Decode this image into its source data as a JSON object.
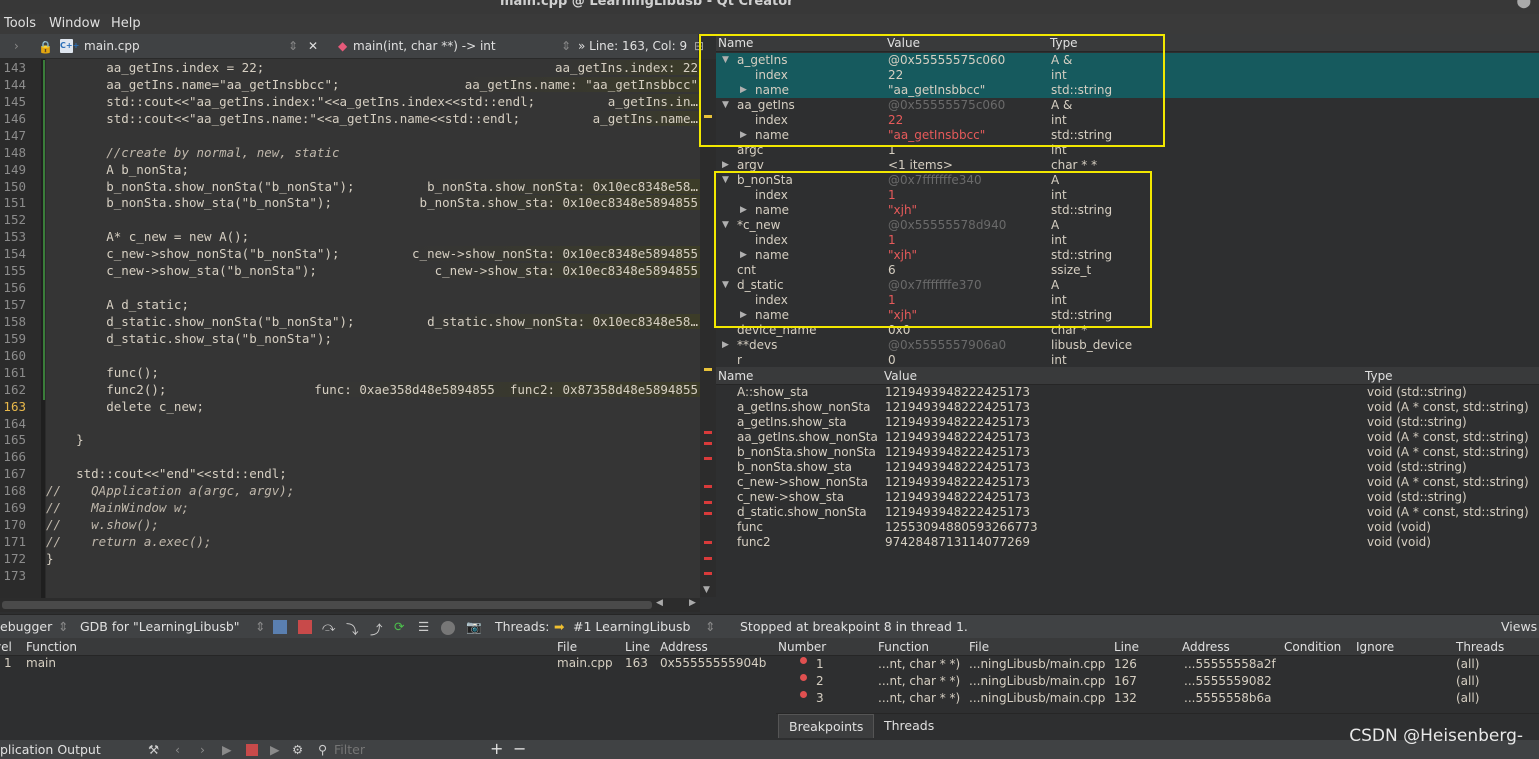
{
  "window": {
    "title": "main.cpp @ LearningLibusb - Qt Creator"
  },
  "menu": [
    "Tools",
    "Window",
    "Help"
  ],
  "editor_toolbar": {
    "file": "main.cpp",
    "function": "main(int, char **) -> int",
    "position": "Line: 163, Col: 9"
  },
  "code_lines": [
    {
      "n": "143",
      "text": "        aa_getIns.index = 22;"
    },
    {
      "n": "144",
      "text": "        aa_getIns.name=\"aa_getInsbbcc\";"
    },
    {
      "n": "145",
      "text": "        std::cout<<\"aa_getIns.index:\"<<a_getIns.index<<std::endl;"
    },
    {
      "n": "146",
      "text": "        std::cout<<\"aa_getIns.name:\"<<a_getIns.name<<std::endl;"
    },
    {
      "n": "147",
      "text": ""
    },
    {
      "n": "148",
      "text": "        //create by normal, new, static"
    },
    {
      "n": "149",
      "text": "        A b_nonSta;"
    },
    {
      "n": "150",
      "text": "        b_nonSta.show_nonSta(\"b_nonSta\");"
    },
    {
      "n": "151",
      "text": "        b_nonSta.show_sta(\"b_nonSta\");"
    },
    {
      "n": "152",
      "text": ""
    },
    {
      "n": "153",
      "text": "        A* c_new = new A();"
    },
    {
      "n": "154",
      "text": "        c_new->show_nonSta(\"b_nonSta\");"
    },
    {
      "n": "155",
      "text": "        c_new->show_sta(\"b_nonSta\");"
    },
    {
      "n": "156",
      "text": ""
    },
    {
      "n": "157",
      "text": "        A d_static;"
    },
    {
      "n": "158",
      "text": "        d_static.show_nonSta(\"b_nonSta\");"
    },
    {
      "n": "159",
      "text": "        d_static.show_sta(\"b_nonSta\");"
    },
    {
      "n": "160",
      "text": ""
    },
    {
      "n": "161",
      "text": "        func();"
    },
    {
      "n": "162",
      "text": "        func2();"
    },
    {
      "n": "163",
      "text": "        delete c_new;"
    },
    {
      "n": "164",
      "text": ""
    },
    {
      "n": "165",
      "text": "    }"
    },
    {
      "n": "166",
      "text": ""
    },
    {
      "n": "167",
      "text": "    std::cout<<\"end\"<<std::endl;"
    },
    {
      "n": "168",
      "text": "//    QApplication a(argc, argv);"
    },
    {
      "n": "169",
      "text": "//    MainWindow w;"
    },
    {
      "n": "170",
      "text": "//    w.show();"
    },
    {
      "n": "171",
      "text": "//    return a.exec();"
    },
    {
      "n": "172",
      "text": "}"
    },
    {
      "n": "173",
      "text": ""
    }
  ],
  "annotations": [
    {
      "line": "143",
      "text": "aa_getIns.index: 22"
    },
    {
      "line": "144",
      "text": "aa_getIns.name: \"aa_getInsbbcc\""
    },
    {
      "line": "145",
      "text": "a_getIns.in…"
    },
    {
      "line": "146",
      "text": "a_getIns.name…"
    },
    {
      "line": "150",
      "text": "b_nonSta.show_nonSta: 0x10ec8348e58…"
    },
    {
      "line": "151",
      "text": "b_nonSta.show_sta: 0x10ec8348e5894855"
    },
    {
      "line": "154",
      "text": "c_new->show_nonSta: 0x10ec8348e5894855"
    },
    {
      "line": "155",
      "text": "c_new->show_sta: 0x10ec8348e5894855"
    },
    {
      "line": "158",
      "text": "d_static.show_nonSta: 0x10ec8348e58…"
    },
    {
      "line": "162",
      "text": "func: 0xae358d48e5894855  func2: 0x87358d48e5894855"
    }
  ],
  "locals": {
    "headers": [
      "Name",
      "Value",
      "Type"
    ],
    "rows": [
      {
        "name": "a_getIns",
        "value": "@0x55555575c060",
        "type": "A &",
        "expander": "open",
        "indent": 0,
        "value_style": "normal",
        "selected": true
      },
      {
        "name": "index",
        "value": "22",
        "type": "int",
        "expander": "",
        "indent": 1,
        "value_style": "normal",
        "selected": true
      },
      {
        "name": "name",
        "value": "\"aa_getInsbbcc\"",
        "type": "std::string",
        "expander": "closed",
        "indent": 1,
        "value_style": "normal",
        "selected": true
      },
      {
        "name": "aa_getIns",
        "value": "@0x55555575c060",
        "type": "A &",
        "expander": "open",
        "indent": 0,
        "value_style": "muted",
        "selected": false
      },
      {
        "name": "index",
        "value": "22",
        "type": "int",
        "expander": "",
        "indent": 1,
        "value_style": "red",
        "selected": false
      },
      {
        "name": "name",
        "value": "\"aa_getInsbbcc\"",
        "type": "std::string",
        "expander": "closed",
        "indent": 1,
        "value_style": "red",
        "selected": false
      },
      {
        "name": "argc",
        "value": "1",
        "type": "int",
        "expander": "",
        "indent": 0,
        "value_style": "normal",
        "selected": false
      },
      {
        "name": "argv",
        "value": "<1 items>",
        "type": "char * *",
        "expander": "closed",
        "indent": 0,
        "value_style": "normal",
        "selected": false
      },
      {
        "name": "b_nonSta",
        "value": "@0x7fffffffe340",
        "type": "A",
        "expander": "open",
        "indent": 0,
        "value_style": "muted",
        "selected": false
      },
      {
        "name": "index",
        "value": "1",
        "type": "int",
        "expander": "",
        "indent": 1,
        "value_style": "red",
        "selected": false
      },
      {
        "name": "name",
        "value": "\"xjh\"",
        "type": "std::string",
        "expander": "closed",
        "indent": 1,
        "value_style": "red",
        "selected": false
      },
      {
        "name": "*c_new",
        "value": "@0x55555578d940",
        "type": "A",
        "expander": "open",
        "indent": 0,
        "value_style": "muted",
        "selected": false
      },
      {
        "name": "index",
        "value": "1",
        "type": "int",
        "expander": "",
        "indent": 1,
        "value_style": "red",
        "selected": false
      },
      {
        "name": "name",
        "value": "\"xjh\"",
        "type": "std::string",
        "expander": "closed",
        "indent": 1,
        "value_style": "red",
        "selected": false
      },
      {
        "name": "cnt",
        "value": "6",
        "type": "ssize_t",
        "expander": "",
        "indent": 0,
        "value_style": "normal",
        "selected": false
      },
      {
        "name": "d_static",
        "value": "@0x7fffffffe370",
        "type": "A",
        "expander": "open",
        "indent": 0,
        "value_style": "muted",
        "selected": false
      },
      {
        "name": "index",
        "value": "1",
        "type": "int",
        "expander": "",
        "indent": 1,
        "value_style": "red",
        "selected": false
      },
      {
        "name": "name",
        "value": "\"xjh\"",
        "type": "std::string",
        "expander": "closed",
        "indent": 1,
        "value_style": "red",
        "selected": false
      },
      {
        "name": "device_name",
        "value": "0x0",
        "type": "char *",
        "expander": "",
        "indent": 0,
        "value_style": "normal",
        "selected": false
      },
      {
        "name": "**devs",
        "value": "@0x5555557906a0",
        "type": "libusb_device",
        "expander": "closed",
        "indent": 0,
        "value_style": "muted",
        "selected": false
      },
      {
        "name": "r",
        "value": "0",
        "type": "int",
        "expander": "",
        "indent": 0,
        "value_style": "normal",
        "selected": false
      }
    ]
  },
  "expressions": {
    "headers": [
      "Name",
      "Value",
      "Type"
    ],
    "rows": [
      {
        "name": "A::show_sta",
        "value": "1219493948222425173",
        "type": "void (std::string)"
      },
      {
        "name": "a_getIns.show_nonSta",
        "value": "1219493948222425173",
        "type": "void (A * const, std::string)"
      },
      {
        "name": "a_getIns.show_sta",
        "value": "1219493948222425173",
        "type": "void (std::string)"
      },
      {
        "name": "aa_getIns.show_nonSta",
        "value": "1219493948222425173",
        "type": "void (A * const, std::string)"
      },
      {
        "name": "b_nonSta.show_nonSta",
        "value": "1219493948222425173",
        "type": "void (A * const, std::string)"
      },
      {
        "name": "b_nonSta.show_sta",
        "value": "1219493948222425173",
        "type": "void (std::string)"
      },
      {
        "name": "c_new->show_nonSta",
        "value": "1219493948222425173",
        "type": "void (A * const, std::string)"
      },
      {
        "name": "c_new->show_sta",
        "value": "1219493948222425173",
        "type": "void (std::string)"
      },
      {
        "name": "d_static.show_nonSta",
        "value": "1219493948222425173",
        "type": "void (A * const, std::string)"
      },
      {
        "name": "func",
        "value": "12553094880593266773",
        "type": "void (void)"
      },
      {
        "name": "func2",
        "value": "9742848713114077269",
        "type": "void (void)"
      }
    ]
  },
  "debug_toolbar": {
    "mode": "ebugger",
    "engine": "GDB for \"LearningLibusb\"",
    "threads_label": "Threads:",
    "thread": "#1 LearningLibusb",
    "status": "Stopped at breakpoint 8 in thread 1.",
    "views": "Views"
  },
  "stack": {
    "headers": [
      "vel",
      "Function",
      "File",
      "Line",
      "Address"
    ],
    "rows": [
      {
        "level": "1",
        "function": "main",
        "file": "main.cpp",
        "line": "163",
        "address": "0x55555555904b"
      }
    ]
  },
  "breakpoints": {
    "headers": [
      "Number",
      "Function",
      "File",
      "Line",
      "Address",
      "Condition",
      "Ignore",
      "Threads"
    ],
    "rows": [
      {
        "number": "1",
        "function": "...nt, char * *)",
        "file": "...ningLibusb/main.cpp",
        "line": "126",
        "address": "...55555558a2f",
        "threads": "(all)"
      },
      {
        "number": "2",
        "function": "...nt, char * *)",
        "file": "...ningLibusb/main.cpp",
        "line": "167",
        "address": "...5555559082",
        "threads": "(all)"
      },
      {
        "number": "3",
        "function": "...nt, char * *)",
        "file": "...ningLibusb/main.cpp",
        "line": "132",
        "address": "...5555558b6a",
        "threads": "(all)"
      }
    ],
    "tabs": [
      "Breakpoints",
      "Threads"
    ]
  },
  "output_bar": {
    "title": "plication Output",
    "filter_placeholder": "Filter"
  },
  "watermark": "CSDN @Heisenberg-"
}
